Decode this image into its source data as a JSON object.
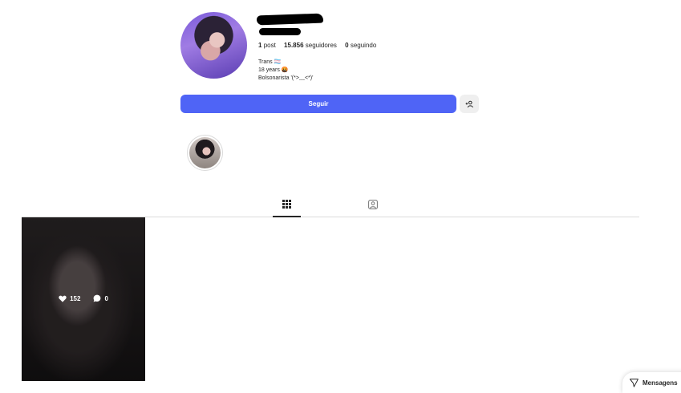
{
  "profile": {
    "stats": {
      "posts_count": "1",
      "posts_label": "post",
      "followers_count": "15.856",
      "followers_label": "seguidores",
      "following_count": "0",
      "following_label": "seguindo"
    },
    "bio": {
      "line1": "Trans 🏳️‍⚧️",
      "line2": "18 years 🤬",
      "line3": "Bolsonarista '(*>﹏<*)'"
    },
    "follow_label": "Seguir",
    "suggest_icon": "add-person-icon"
  },
  "tabs": [
    {
      "name": "posts",
      "icon": "grid-icon",
      "active": true
    },
    {
      "name": "tagged",
      "icon": "tagged-icon",
      "active": false
    }
  ],
  "posts": [
    {
      "likes": "152",
      "comments": "0"
    }
  ],
  "messages": {
    "label": "Mensagens",
    "icon": "send-icon"
  },
  "colors": {
    "accent": "#4f64f6",
    "text": "#262626",
    "divider": "#dbdbdb"
  }
}
